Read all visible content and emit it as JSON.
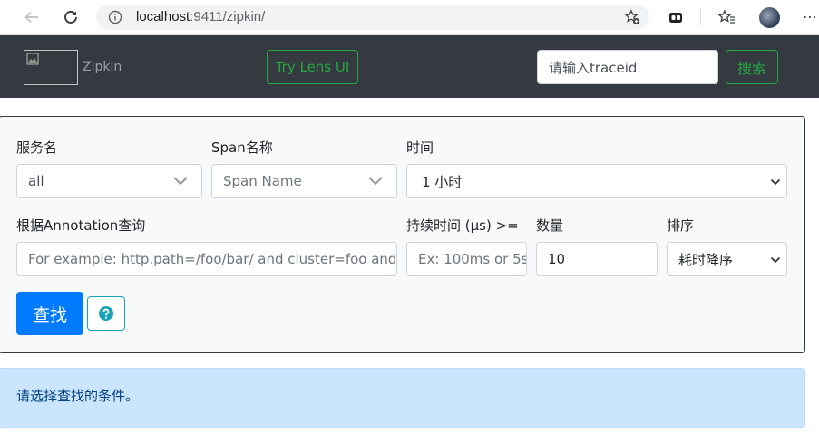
{
  "browser": {
    "url_host": "localhost",
    "url_rest": ":9411/zipkin/"
  },
  "navbar": {
    "brand": "Zipkin",
    "lens_button": "Try Lens UI",
    "traceid_placeholder": "请输入traceid",
    "search_button": "搜索"
  },
  "form": {
    "service_label": "服务名",
    "service_value": "all",
    "span_label": "Span名称",
    "span_placeholder": "Span Name",
    "time_label": "时间",
    "time_value": "1 小时",
    "annotation_label": "根据Annotation查询",
    "annotation_placeholder": "For example: http.path=/foo/bar/ and cluster=foo and c",
    "duration_label": "持续时间 (μs) >=",
    "duration_placeholder": "Ex: 100ms or 5s",
    "limit_label": "数量",
    "limit_value": "10",
    "sort_label": "排序",
    "sort_value": "耗时降序",
    "find_button": "查找",
    "help_icon": "question-circle-icon"
  },
  "alert": {
    "message": "请选择查找的条件。"
  },
  "colors": {
    "navbar_bg": "#343a40",
    "success": "#28a745",
    "primary": "#007bff",
    "info": "#17a2b8",
    "alert_bg": "#cce5ff",
    "alert_text": "#004085"
  }
}
